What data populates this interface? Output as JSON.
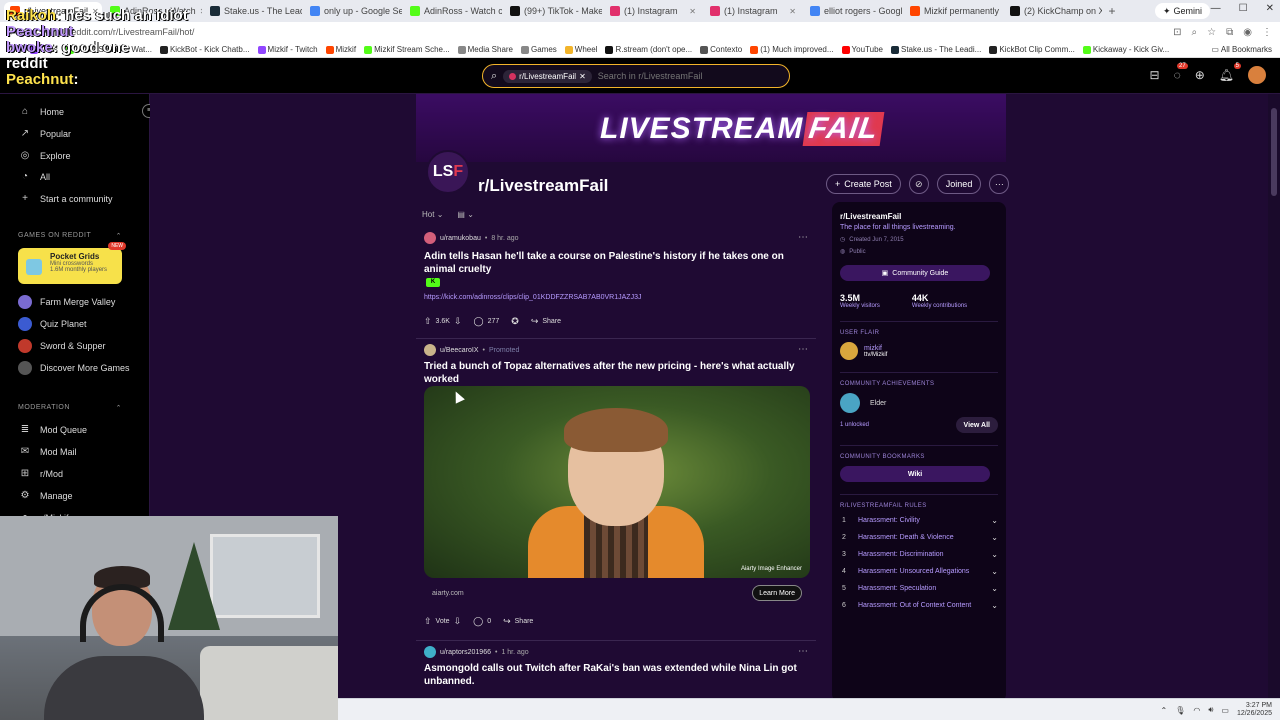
{
  "browser": {
    "tabs": [
      {
        "label": "r/LivestreamFail",
        "color": "#ff4500",
        "active": true
      },
      {
        "label": "AdinRoss - Watch",
        "color": "#53fc18"
      },
      {
        "label": "Stake.us - The Leading",
        "color": "#1a2c38"
      },
      {
        "label": "only up - Google Search",
        "color": "#4285f4"
      },
      {
        "label": "AdinRoss - Watch clips",
        "color": "#53fc18"
      },
      {
        "label": "(99+) TikTok - Make Your",
        "color": "#111111"
      },
      {
        "label": "(1) Instagram",
        "color": "#e1306c"
      },
      {
        "label": "(1) Instagram",
        "color": "#e1306c"
      },
      {
        "label": "elliot rogers - Google Se",
        "color": "#4285f4"
      },
      {
        "label": "Mizkif permanently ban",
        "color": "#ff4500"
      },
      {
        "label": "(2) KickChamp on X",
        "color": "#111111"
      }
    ],
    "gemini_label": "Gemini",
    "url": "reddit.com/r/LivestreamFail/hot/",
    "bookmarks": [
      {
        "label": "Clips",
        "color": "#9146ff"
      },
      {
        "label": "Mizkif Stream - Wat...",
        "color": "#53fc18"
      },
      {
        "label": "KickBot - Kick Chatb...",
        "color": "#222222"
      },
      {
        "label": "Mizkif - Twitch",
        "color": "#9146ff"
      },
      {
        "label": "Mizkif",
        "color": "#ff4500"
      },
      {
        "label": "Mizkif Stream Sche...",
        "color": "#53fc18"
      },
      {
        "label": "Media Share",
        "color": "#888888"
      },
      {
        "label": "Games",
        "color": "#888888"
      },
      {
        "label": "Wheel",
        "color": "#f2b42a"
      },
      {
        "label": "R.stream (don't ope...",
        "color": "#111111"
      },
      {
        "label": "Contexto",
        "color": "#555555"
      },
      {
        "label": "(1) Much improved...",
        "color": "#ff4500"
      },
      {
        "label": "YouTube",
        "color": "#ff0000"
      },
      {
        "label": "Stake.us - The Leadi...",
        "color": "#1a2c38"
      },
      {
        "label": "KickBot Clip Comm...",
        "color": "#222222"
      },
      {
        "label": "Kickaway - Kick Giv...",
        "color": "#53fc18"
      }
    ],
    "all_bookmarks": "All Bookmarks"
  },
  "header": {
    "search_chip": "r/LivestreamFail",
    "search_placeholder": "Search in r/LivestreamFail",
    "chat_badge": "27",
    "notif_badge": "5"
  },
  "overlay": {
    "chat": [
      {
        "user": "Raikoh",
        "text": ": hes such an idiot",
        "color": "yellow"
      },
      {
        "user": "Peachnut",
        "text": "",
        "color": "purple"
      },
      {
        "user": "bwoke",
        "text": ": good one",
        "color": "purple"
      },
      {
        "user": "reddit",
        "text": "",
        "color": "plain"
      },
      {
        "user": "Peachnut",
        "text": ":",
        "color": "yellow"
      }
    ]
  },
  "sidebar": {
    "nav": [
      {
        "label": "Home",
        "icon": "home-icon",
        "glyph": "⌂"
      },
      {
        "label": "Popular",
        "icon": "popular-icon",
        "glyph": "↗"
      },
      {
        "label": "Explore",
        "icon": "explore-icon",
        "glyph": "◎"
      },
      {
        "label": "All",
        "icon": "all-icon",
        "glyph": "◔"
      },
      {
        "label": "Start a community",
        "icon": "plus-icon",
        "glyph": "+"
      }
    ],
    "games_heading": "GAMES ON REDDIT",
    "featured_game": {
      "title": "Pocket Grids",
      "subtitle": "Mini crosswords",
      "players": "1.6M monthly players",
      "badge": "NEW"
    },
    "games": [
      {
        "label": "Farm Merge Valley",
        "color": "#7a6bd1"
      },
      {
        "label": "Quiz Planet",
        "color": "#3b5bd1"
      },
      {
        "label": "Sword & Supper",
        "color": "#c0392b"
      },
      {
        "label": "Discover More Games",
        "color": "#555555"
      }
    ],
    "moderation_heading": "MODERATION",
    "moderation": [
      {
        "label": "Mod Queue",
        "glyph": "≣"
      },
      {
        "label": "Mod Mail",
        "glyph": "✉"
      },
      {
        "label": "r/Mod",
        "glyph": "⊞"
      },
      {
        "label": "Manage",
        "glyph": "⚙"
      },
      {
        "label": "r/Mizkif",
        "glyph": "●"
      }
    ]
  },
  "subreddit": {
    "banner_text": "LIVESTREAM",
    "banner_fail": "FAIL",
    "icon_text": "LS",
    "icon_red": "F",
    "name": "r/LivestreamFail",
    "create_post": "Create Post",
    "joined": "Joined",
    "sort": "Hot",
    "view": "▤"
  },
  "posts": [
    {
      "user": "u/ramukobau",
      "time": "8 hr. ago",
      "title": "Adin tells Hasan he'll take a course on Palestine's history if he takes one on animal cruelty",
      "link": "https://kick.com/adinross/clips/clip_01KDDFZZRSAB7AB0VR1JAZJ3J",
      "votes": "3.6K",
      "comments": "277",
      "share": "Share"
    },
    {
      "user": "u/BeecaroIX",
      "promoted": "Promoted",
      "title": "Tried a bunch of Topaz alternatives after the new pricing - here's what actually worked",
      "image_tag": "Aiarty Image Enhancer",
      "domain": "aiarty.com",
      "cta": "Learn More",
      "votes": "Vote",
      "comments": "0",
      "share": "Share"
    },
    {
      "user": "u/raptors201966",
      "time": "1 hr. ago",
      "title": "Asmongold calls out Twitch after RaKai's ban was extended while Nina Lin got unbanned."
    }
  ],
  "about": {
    "title": "r/LivestreamFail",
    "description": "The place for all things livestreaming.",
    "created": "Created Jun 7, 2015",
    "visibility": "Public",
    "guide_button": "Community Guide",
    "stats": [
      {
        "value": "3.5M",
        "label": "Weekly visitors"
      },
      {
        "value": "44K",
        "label": "Weekly contributions"
      }
    ],
    "flair_heading": "USER FLAIR",
    "flair_user": "mizkif",
    "flair_text": "ttv/Mizkif",
    "achievements_heading": "COMMUNITY ACHIEVEMENTS",
    "achievement_name": "Elder",
    "unlocked": "1 unlocked",
    "view_all": "View All",
    "bookmarks_heading": "COMMUNITY BOOKMARKS",
    "wiki": "Wiki",
    "rules_heading": "R/LIVESTREAMFAIL RULES",
    "rules": [
      {
        "n": "1",
        "text": "Harassment: Civility"
      },
      {
        "n": "2",
        "text": "Harassment: Death & Violence"
      },
      {
        "n": "3",
        "text": "Harassment: Discrimination"
      },
      {
        "n": "4",
        "text": "Harassment: Unsourced Allegations"
      },
      {
        "n": "5",
        "text": "Harassment: Speculation"
      },
      {
        "n": "6",
        "text": "Harassment: Out of Context Content"
      }
    ]
  },
  "taskbar": {
    "time": "3:27 PM",
    "date": "12/26/2025"
  }
}
